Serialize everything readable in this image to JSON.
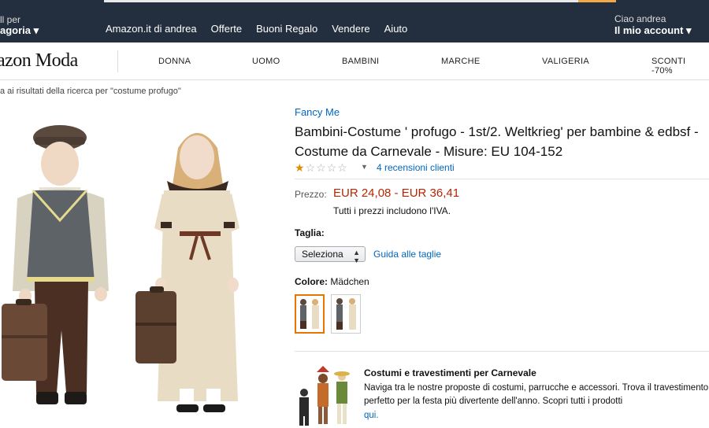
{
  "nav": {
    "category_small": "ll per",
    "category_big": "agoria ▾",
    "links": [
      "Amazon.it di andrea",
      "Offerte",
      "Buoni Regalo",
      "Vendere",
      "Aiuto"
    ],
    "account_small": "Ciao andrea",
    "account_big": "Il mio account ▾"
  },
  "moda": {
    "logo": "azon Moda",
    "categories": [
      "DONNA",
      "UOMO",
      "BAMBINI",
      "MARCHE",
      "VALIGERIA",
      "SCONTI -70%"
    ]
  },
  "breadcrumb": "a ai risultati della ricerca per \"costume profugo\"",
  "product": {
    "brand": "Fancy Me",
    "title": "Bambini-Costume ' profugo - 1st/2. Weltkrieg' per bambine & edbsf - Costume da Carnevale - Misure: EU 104-152",
    "rating": 1,
    "rating_max": 5,
    "reviews": "4 recensioni clienti",
    "price_label": "Prezzo:",
    "price": "EUR 24,08 - EUR 36,41",
    "vat_note": "Tutti i prezzi includono l'IVA.",
    "size_label": "Taglia:",
    "size_selected": "Seleziona",
    "size_guide": "Guida alle taglie",
    "color_label": "Colore:",
    "color_value": "Mädchen"
  },
  "promo": {
    "title": "Costumi e travestimenti per Carnevale",
    "text": "Naviga tra le nostre proposte di costumi, parrucche e accessori. Trova il travestimento perfetto per la festa più divertente dell'anno. Scopri tutti i prodotti",
    "link": "qui."
  },
  "colors": {
    "nav_bg": "#232f3e",
    "link": "#0066c0",
    "price": "#b12704",
    "star": "#e08d00",
    "swatch_selected": "#e77600"
  }
}
